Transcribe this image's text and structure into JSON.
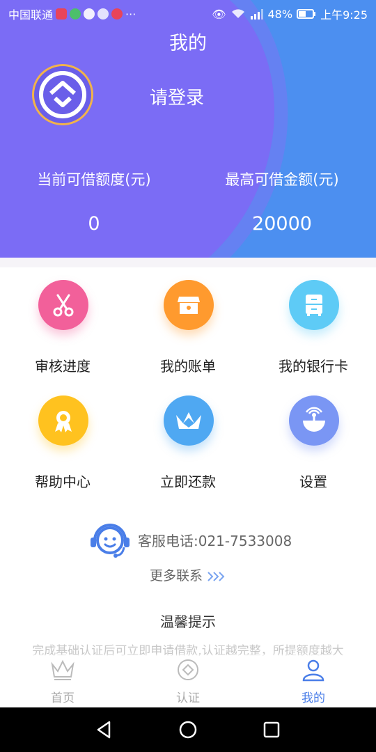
{
  "status_bar": {
    "carrier": "中国联通",
    "battery": "48%",
    "time": "上午9:25",
    "more": "···"
  },
  "header": {
    "title": "我的",
    "login": "请登录",
    "current_credit_label": "当前可借额度(元)",
    "current_credit_value": "0",
    "max_credit_label": "最高可借金额(元)",
    "max_credit_value": "20000"
  },
  "menu": [
    {
      "label": "审核进度",
      "icon": "scissors-icon",
      "color": "#f2609a"
    },
    {
      "label": "我的账单",
      "icon": "bill-box-icon",
      "color": "#ff9a2e"
    },
    {
      "label": "我的银行卡",
      "icon": "cabinet-icon",
      "color": "#5ecbf6"
    },
    {
      "label": "帮助中心",
      "icon": "award-icon",
      "color": "#ffc21f"
    },
    {
      "label": "立即还款",
      "icon": "crown-icon",
      "color": "#4fa8f2"
    },
    {
      "label": "设置",
      "icon": "antenna-icon",
      "color": "#7a96f4"
    }
  ],
  "service": {
    "phone_text": "客服电话:021-7533008",
    "more_contact": "更多联系"
  },
  "tips": {
    "title": "温馨提示",
    "text": "完成基础认证后可立即申请借款,认证越完整，所提额度越大"
  },
  "tabs": [
    {
      "label": "首页",
      "icon": "crown-outline-icon",
      "active": false
    },
    {
      "label": "认证",
      "icon": "badge-outline-icon",
      "active": false
    },
    {
      "label": "我的",
      "icon": "user-icon",
      "active": true
    }
  ],
  "colors": {
    "header_purple": "#7b6cf5",
    "header_blue": "#4c8ff0",
    "accent_blue": "#4a7ee8",
    "avatar_ring": "#f2b34a"
  }
}
